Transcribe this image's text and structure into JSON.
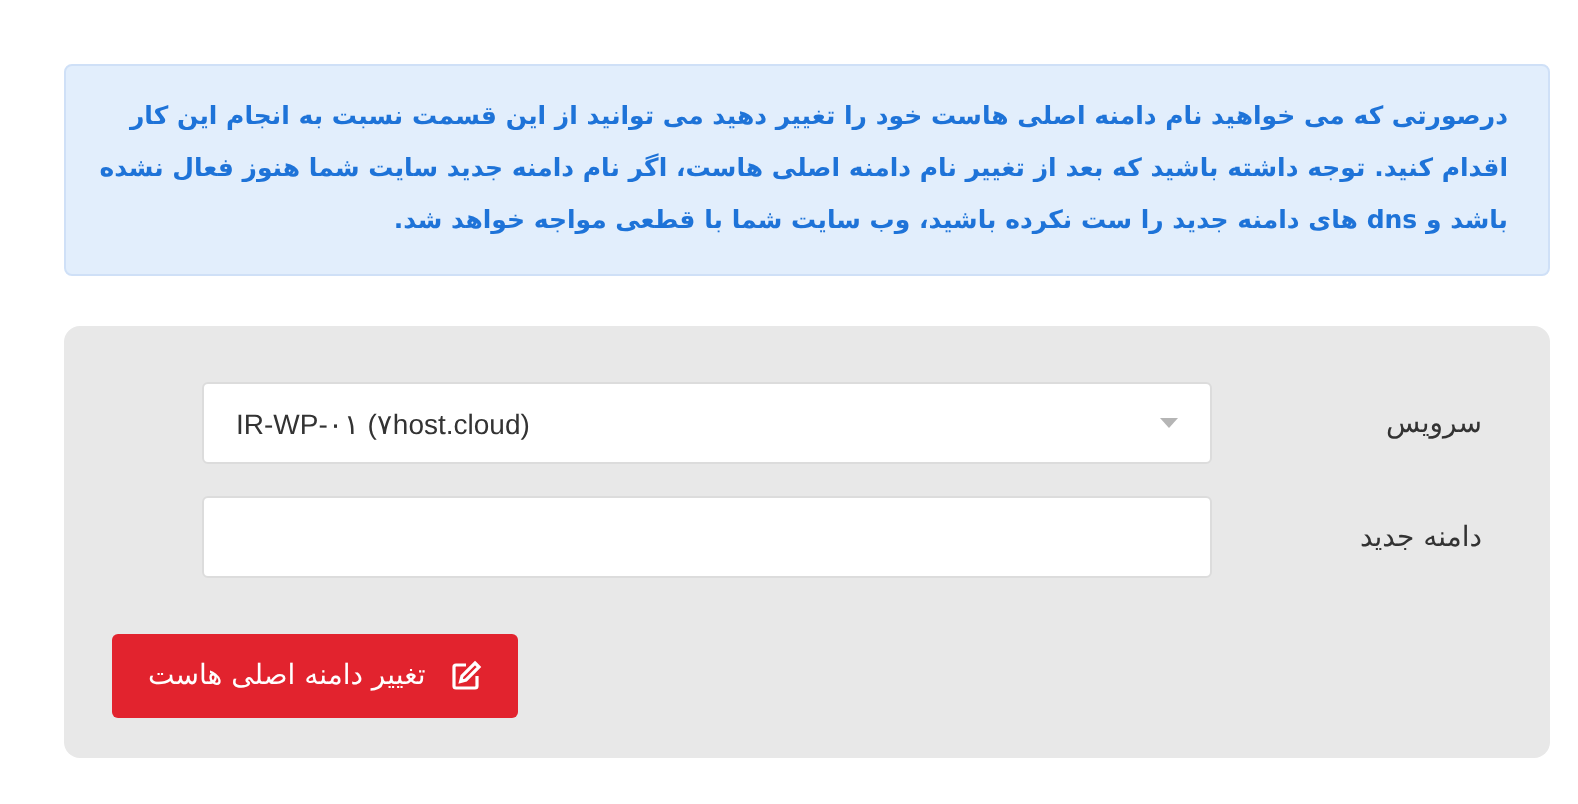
{
  "alert": {
    "text": "درصورتی که می خواهید نام دامنه اصلی هاست خود را تغییر دهید می توانید از این قسمت نسبت به انجام این کار اقدام کنید. توجه داشته باشید که بعد از تغییر نام دامنه اصلی هاست، اگر نام دامنه جدید سایت شما هنوز فعال نشده باشد و dns های دامنه جدید را ست نکرده باشید، وب سایت شما با قطعی مواجه خواهد شد."
  },
  "form": {
    "fields": [
      {
        "kind": "select",
        "label": "سرویس",
        "value": "IR-WP-۰۱ (۷host.cloud)"
      },
      {
        "kind": "text",
        "label": "دامنه جدید"
      }
    ],
    "submit": {
      "label": "تغییر دامنه اصلی هاست"
    }
  }
}
